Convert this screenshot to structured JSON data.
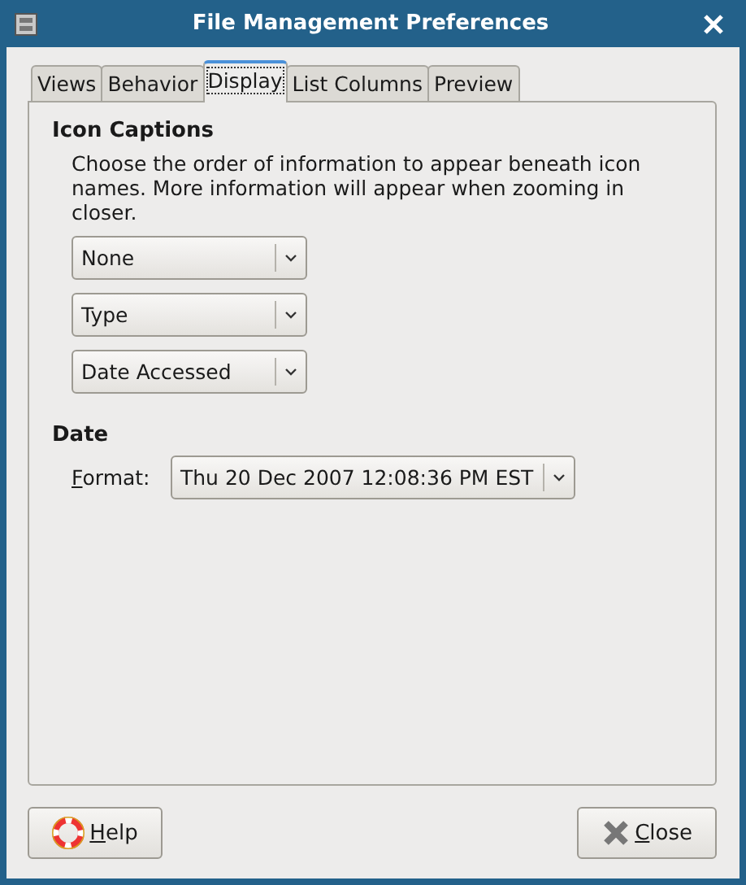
{
  "window": {
    "title": "File Management Preferences"
  },
  "tabs": [
    {
      "label": "Views",
      "selected": false
    },
    {
      "label": "Behavior",
      "selected": false
    },
    {
      "label": "Display",
      "selected": true
    },
    {
      "label": "List Columns",
      "selected": false
    },
    {
      "label": "Preview",
      "selected": false
    }
  ],
  "icon_captions": {
    "heading": "Icon Captions",
    "description": "Choose the order of information to appear beneath icon names. More information will appear when zooming in closer.",
    "dropdowns": [
      "None",
      "Type",
      "Date Accessed"
    ]
  },
  "date": {
    "heading": "Date",
    "format_label": "Format:",
    "format_mnemonic": true,
    "format_value": "Thu 20 Dec 2007 12:08:36 PM EST"
  },
  "buttons": [
    {
      "kind": "help",
      "label": "Help",
      "mnemonic": true
    },
    {
      "kind": "close",
      "label": "Close",
      "mnemonic": true
    }
  ]
}
